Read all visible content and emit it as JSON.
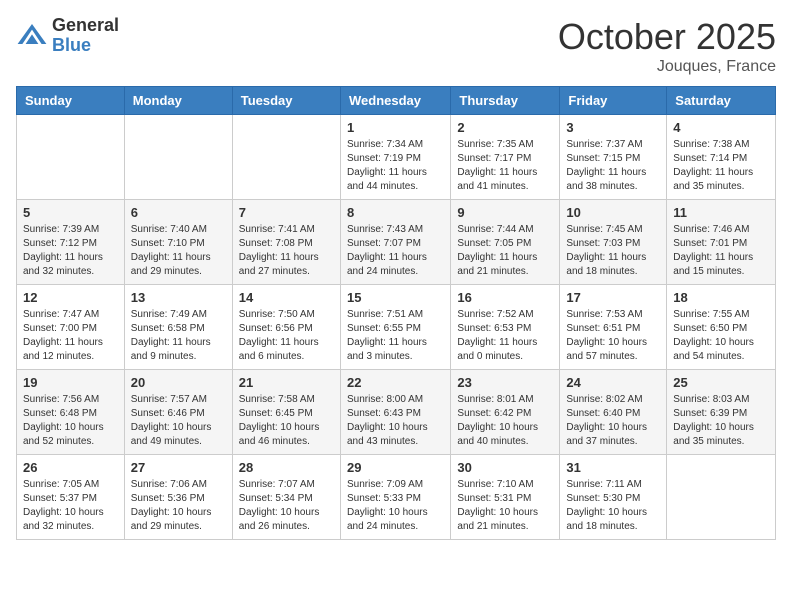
{
  "header": {
    "logo_general": "General",
    "logo_blue": "Blue",
    "month_title": "October 2025",
    "location": "Jouques, France"
  },
  "days_of_week": [
    "Sunday",
    "Monday",
    "Tuesday",
    "Wednesday",
    "Thursday",
    "Friday",
    "Saturday"
  ],
  "weeks": [
    [
      {
        "day": "",
        "info": ""
      },
      {
        "day": "",
        "info": ""
      },
      {
        "day": "",
        "info": ""
      },
      {
        "day": "1",
        "info": "Sunrise: 7:34 AM\nSunset: 7:19 PM\nDaylight: 11 hours and 44 minutes."
      },
      {
        "day": "2",
        "info": "Sunrise: 7:35 AM\nSunset: 7:17 PM\nDaylight: 11 hours and 41 minutes."
      },
      {
        "day": "3",
        "info": "Sunrise: 7:37 AM\nSunset: 7:15 PM\nDaylight: 11 hours and 38 minutes."
      },
      {
        "day": "4",
        "info": "Sunrise: 7:38 AM\nSunset: 7:14 PM\nDaylight: 11 hours and 35 minutes."
      }
    ],
    [
      {
        "day": "5",
        "info": "Sunrise: 7:39 AM\nSunset: 7:12 PM\nDaylight: 11 hours and 32 minutes."
      },
      {
        "day": "6",
        "info": "Sunrise: 7:40 AM\nSunset: 7:10 PM\nDaylight: 11 hours and 29 minutes."
      },
      {
        "day": "7",
        "info": "Sunrise: 7:41 AM\nSunset: 7:08 PM\nDaylight: 11 hours and 27 minutes."
      },
      {
        "day": "8",
        "info": "Sunrise: 7:43 AM\nSunset: 7:07 PM\nDaylight: 11 hours and 24 minutes."
      },
      {
        "day": "9",
        "info": "Sunrise: 7:44 AM\nSunset: 7:05 PM\nDaylight: 11 hours and 21 minutes."
      },
      {
        "day": "10",
        "info": "Sunrise: 7:45 AM\nSunset: 7:03 PM\nDaylight: 11 hours and 18 minutes."
      },
      {
        "day": "11",
        "info": "Sunrise: 7:46 AM\nSunset: 7:01 PM\nDaylight: 11 hours and 15 minutes."
      }
    ],
    [
      {
        "day": "12",
        "info": "Sunrise: 7:47 AM\nSunset: 7:00 PM\nDaylight: 11 hours and 12 minutes."
      },
      {
        "day": "13",
        "info": "Sunrise: 7:49 AM\nSunset: 6:58 PM\nDaylight: 11 hours and 9 minutes."
      },
      {
        "day": "14",
        "info": "Sunrise: 7:50 AM\nSunset: 6:56 PM\nDaylight: 11 hours and 6 minutes."
      },
      {
        "day": "15",
        "info": "Sunrise: 7:51 AM\nSunset: 6:55 PM\nDaylight: 11 hours and 3 minutes."
      },
      {
        "day": "16",
        "info": "Sunrise: 7:52 AM\nSunset: 6:53 PM\nDaylight: 11 hours and 0 minutes."
      },
      {
        "day": "17",
        "info": "Sunrise: 7:53 AM\nSunset: 6:51 PM\nDaylight: 10 hours and 57 minutes."
      },
      {
        "day": "18",
        "info": "Sunrise: 7:55 AM\nSunset: 6:50 PM\nDaylight: 10 hours and 54 minutes."
      }
    ],
    [
      {
        "day": "19",
        "info": "Sunrise: 7:56 AM\nSunset: 6:48 PM\nDaylight: 10 hours and 52 minutes."
      },
      {
        "day": "20",
        "info": "Sunrise: 7:57 AM\nSunset: 6:46 PM\nDaylight: 10 hours and 49 minutes."
      },
      {
        "day": "21",
        "info": "Sunrise: 7:58 AM\nSunset: 6:45 PM\nDaylight: 10 hours and 46 minutes."
      },
      {
        "day": "22",
        "info": "Sunrise: 8:00 AM\nSunset: 6:43 PM\nDaylight: 10 hours and 43 minutes."
      },
      {
        "day": "23",
        "info": "Sunrise: 8:01 AM\nSunset: 6:42 PM\nDaylight: 10 hours and 40 minutes."
      },
      {
        "day": "24",
        "info": "Sunrise: 8:02 AM\nSunset: 6:40 PM\nDaylight: 10 hours and 37 minutes."
      },
      {
        "day": "25",
        "info": "Sunrise: 8:03 AM\nSunset: 6:39 PM\nDaylight: 10 hours and 35 minutes."
      }
    ],
    [
      {
        "day": "26",
        "info": "Sunrise: 7:05 AM\nSunset: 5:37 PM\nDaylight: 10 hours and 32 minutes."
      },
      {
        "day": "27",
        "info": "Sunrise: 7:06 AM\nSunset: 5:36 PM\nDaylight: 10 hours and 29 minutes."
      },
      {
        "day": "28",
        "info": "Sunrise: 7:07 AM\nSunset: 5:34 PM\nDaylight: 10 hours and 26 minutes."
      },
      {
        "day": "29",
        "info": "Sunrise: 7:09 AM\nSunset: 5:33 PM\nDaylight: 10 hours and 24 minutes."
      },
      {
        "day": "30",
        "info": "Sunrise: 7:10 AM\nSunset: 5:31 PM\nDaylight: 10 hours and 21 minutes."
      },
      {
        "day": "31",
        "info": "Sunrise: 7:11 AM\nSunset: 5:30 PM\nDaylight: 10 hours and 18 minutes."
      },
      {
        "day": "",
        "info": ""
      }
    ]
  ]
}
